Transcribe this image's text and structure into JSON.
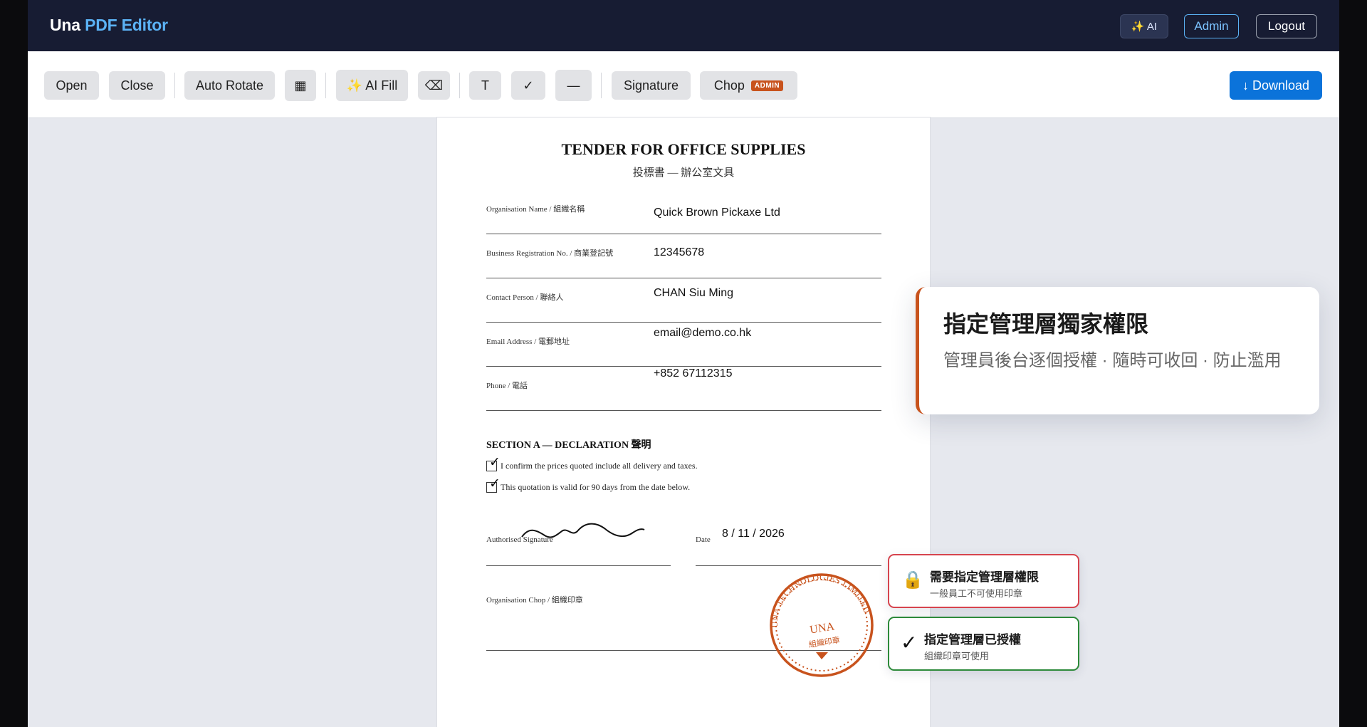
{
  "app": {
    "brand_prefix": "Una",
    "brand_accent": "PDF Editor",
    "header_buttons": {
      "ai": "✨ AI",
      "admin": "Admin",
      "logout": "Logout"
    }
  },
  "toolbar": {
    "open": "Open",
    "close": "Close",
    "auto_rotate": "Auto Rotate",
    "grid_icon": "▦",
    "ai_fill": "✨ AI Fill",
    "eraser_icon": "⌫",
    "text_tool": "T",
    "check_tool": "✓",
    "line_tool": "—",
    "signature": "Signature",
    "chop": "Chop",
    "chop_badge": "ADMIN",
    "download": "↓ Download"
  },
  "document": {
    "title": "TENDER FOR OFFICE SUPPLIES",
    "subtitle": "投標書 — 辦公室文具",
    "fields": [
      {
        "label": "Organisation Name / 組織名稱",
        "value": "Quick Brown Pickaxe Ltd"
      },
      {
        "label": "Business Registration No. / 商業登記號",
        "value": "12345678"
      },
      {
        "label": "Contact Person / 聯絡人",
        "value": "CHAN Siu Ming"
      },
      {
        "label": "Email Address / 電郵地址",
        "value": "email@demo.co.hk"
      },
      {
        "label": "Phone / 電話",
        "value": "+852 67112315"
      }
    ],
    "section_title": "SECTION A — DECLARATION 聲明",
    "declarations": [
      {
        "text": "I confirm the prices quoted include all delivery and taxes.",
        "checked": true
      },
      {
        "text": "This quotation is valid for 90 days from the date below.",
        "checked": true
      }
    ],
    "signature_label": "Authorised Signature",
    "date_label": "Date",
    "date_value": "8 / 11 / 2026",
    "chop_label": "Organisation Chop / 組織印章",
    "stamp": {
      "ring_text": "UNA TECHNOLOGIES LIMITED",
      "center_text": "UNA",
      "center_sub": "組織印章",
      "color": "#c8531d"
    }
  },
  "callout": {
    "title": "指定管理層獨家權限",
    "subtitle": "管理員後台逐個授權 · 隨時可收回 · 防止濫用",
    "accent": "#c8531d"
  },
  "notices": [
    {
      "icon": "🔒",
      "title": "需要指定管理層權限",
      "subtitle": "一般員工不可使用印章",
      "state": "locked"
    },
    {
      "icon": "✓",
      "title": "指定管理層已授權",
      "subtitle": "組織印章可使用",
      "state": "granted"
    }
  ]
}
